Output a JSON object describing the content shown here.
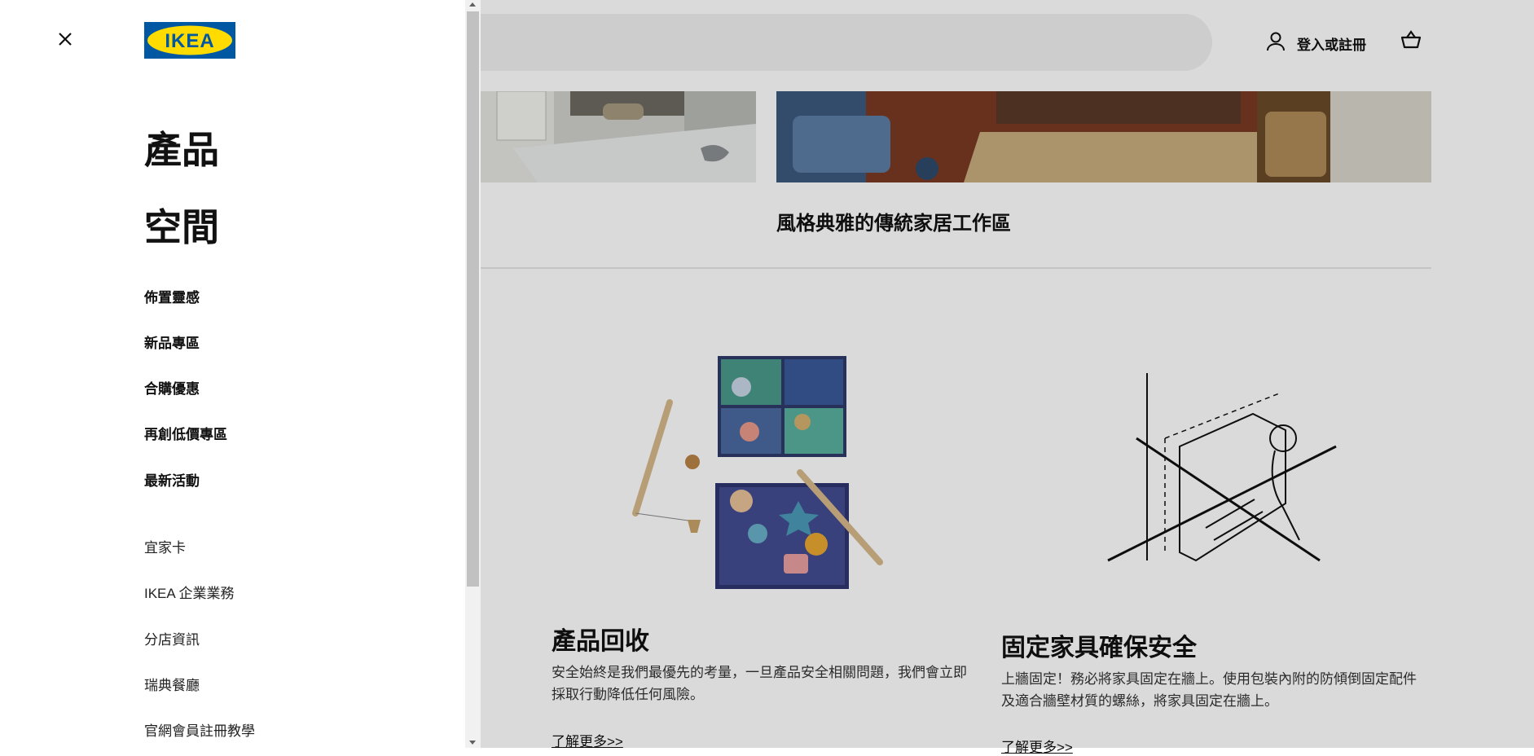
{
  "header": {
    "login_label": "登入或註冊"
  },
  "hero": {
    "caption": "風格典雅的傳統家居工作區"
  },
  "cards": [
    {
      "title": "產品回收",
      "body": "安全始終是我們最優先的考量，一旦產品安全相關問題，我們會立即採取行動降低任何風險。",
      "link": "了解更多>>"
    },
    {
      "title": "固定家具確保安全",
      "body": "上牆固定！務必將家具固定在牆上。使用包裝內附的防傾倒固定配件及適合牆壁材質的螺絲，將家具固定在牆上。",
      "link": "了解更多>>"
    }
  ],
  "menu": {
    "logo_text": "IKEA",
    "primary": [
      "產品",
      "空間"
    ],
    "secondary": [
      "佈置靈感",
      "新品專區",
      "合購優惠",
      "再創低價專區",
      "最新活動"
    ],
    "tertiary": [
      "宜家卡",
      "IKEA 企業業務",
      "分店資訊",
      "瑞典餐廳",
      "官網會員註冊教學"
    ]
  },
  "colors": {
    "ikea_blue": "#0058a3",
    "ikea_yellow": "#ffdb00",
    "overlay": "rgba(0,0,0,0.145)"
  },
  "icons": [
    "close-icon",
    "user-icon",
    "cart-icon"
  ]
}
